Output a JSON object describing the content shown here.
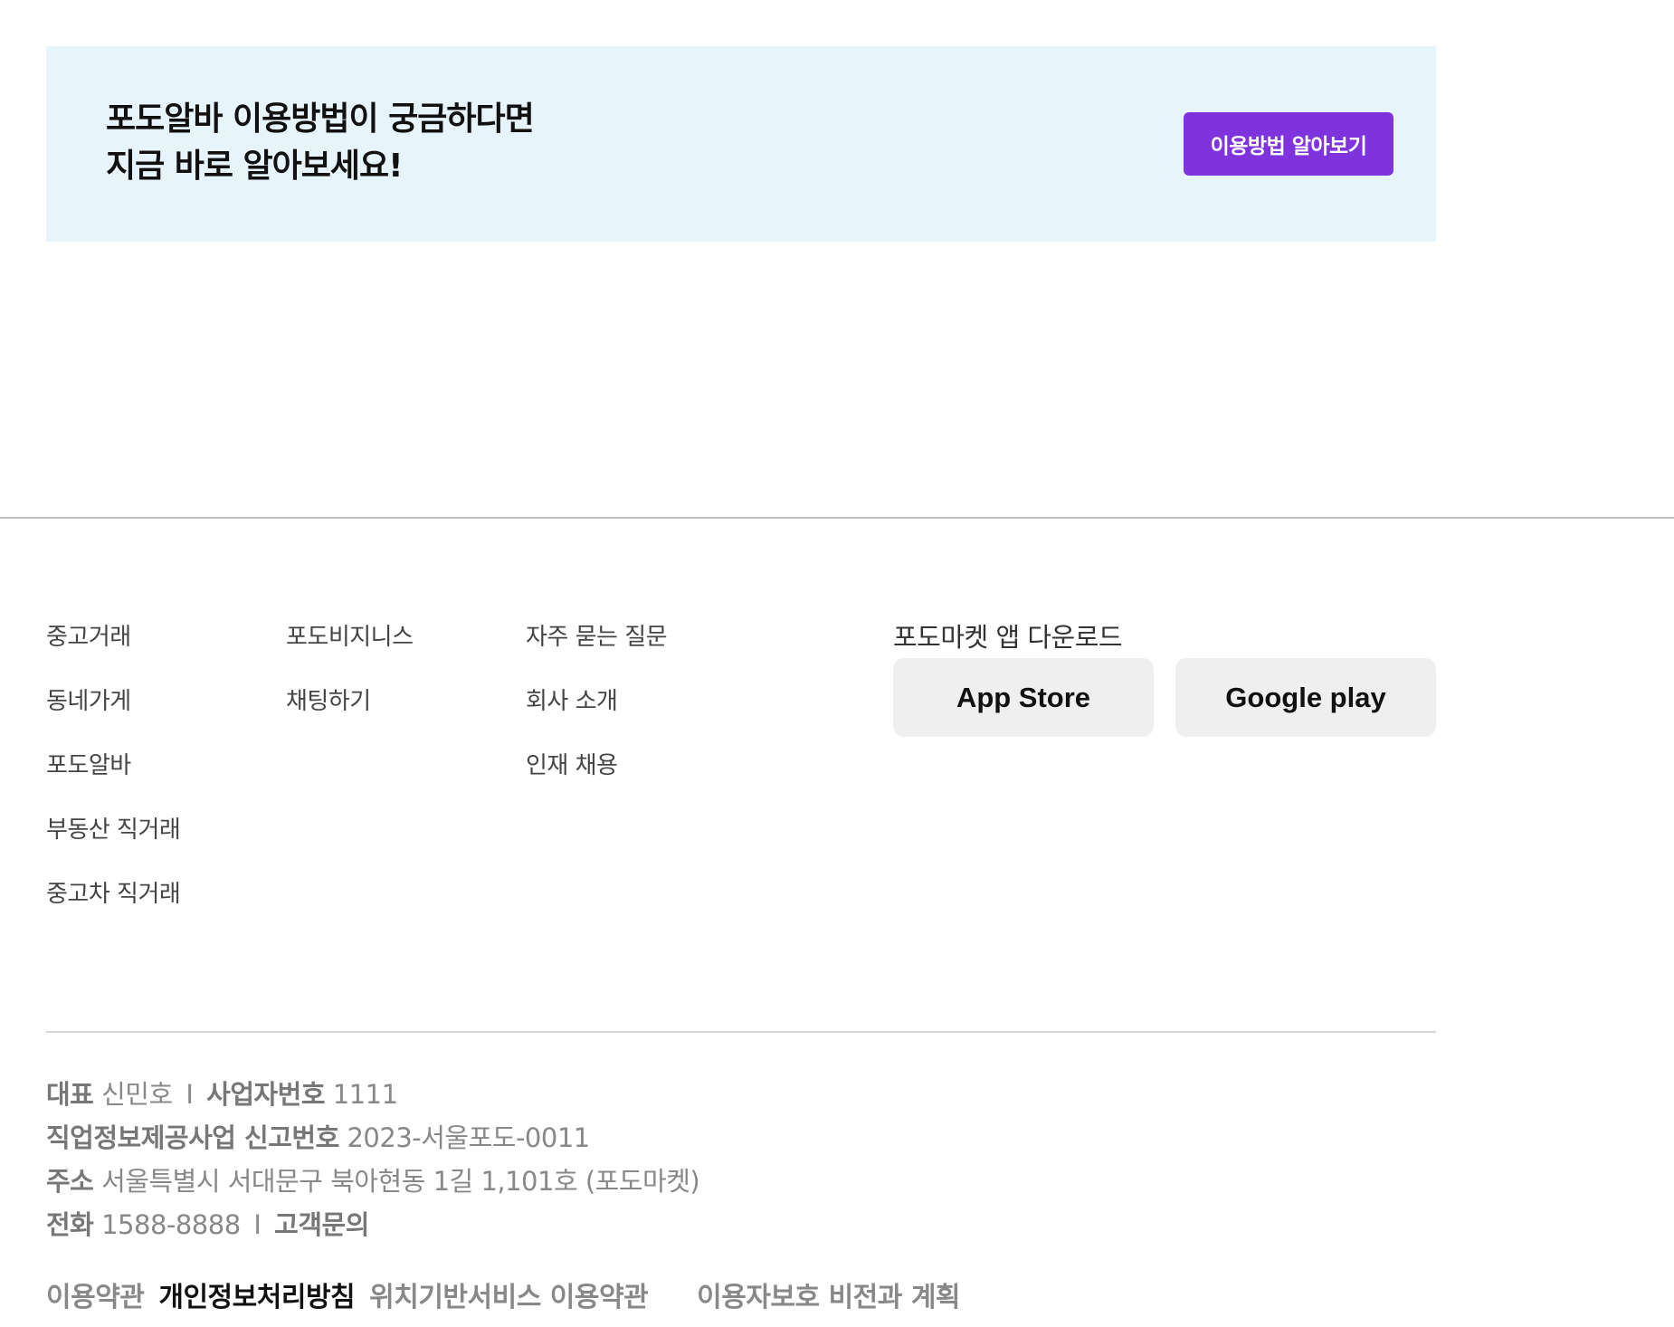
{
  "banner": {
    "title_line1": "포도알바 이용방법이 궁금하다면",
    "title_line2": "지금 바로 알아보세요!",
    "button_label": "이용방법 알아보기",
    "background_color": "#e7f4fc",
    "button_color": "#7f33dd"
  },
  "footer": {
    "columns": [
      [
        "중고거래",
        "동네가게",
        "포도알바",
        "부동산 직거래",
        "중고차 직거래"
      ],
      [
        "포도비지니스",
        "채팅하기"
      ],
      [
        "자주 묻는 질문",
        "회사 소개",
        "인재 채용"
      ]
    ],
    "app_download": {
      "title": "포도마켓 앱 다운로드",
      "app_store_label": "App Store",
      "google_play_label": "Google play"
    },
    "info": {
      "ceo_label": "대표",
      "ceo_value": "신민호",
      "separator": "I",
      "business_no_label": "사업자번호",
      "business_no_value": "1111",
      "job_info_label": "직업정보제공사업 신고번호",
      "job_info_value": "2023-서울포도-0011",
      "address_label": "주소",
      "address_value": "서울특별시 서대문구 북아현동 1길 1,101호 (포도마켓)",
      "phone_label": "전화",
      "phone_value": "1588-8888",
      "inquiry_label": "고객문의"
    },
    "policies": {
      "terms": "이용약관",
      "privacy": "개인정보처리방침",
      "location_terms": "위치기반서비스 이용약관",
      "user_protection": "이용자보호 비전과 계획"
    }
  }
}
